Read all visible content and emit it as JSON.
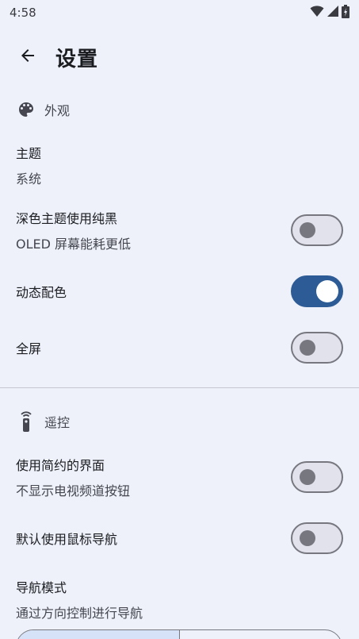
{
  "status_bar": {
    "time": "4:58",
    "icons": [
      "wifi-icon",
      "signal-icon",
      "battery-icon"
    ]
  },
  "header": {
    "title": "设置",
    "back_icon": "arrow-left-icon"
  },
  "appearance": {
    "section_label": "外观",
    "icon": "palette-icon",
    "theme": {
      "title": "主题",
      "value": "系统"
    },
    "pure_black": {
      "title": "深色主题使用纯黑",
      "subtitle": "OLED 屏幕能耗更低",
      "enabled": false
    },
    "dynamic_color": {
      "title": "动态配色",
      "enabled": true
    },
    "fullscreen": {
      "title": "全屏",
      "enabled": false
    }
  },
  "remote": {
    "section_label": "遥控",
    "icon": "remote-icon",
    "simple_ui": {
      "title": "使用简约的界面",
      "subtitle": "不显示电视频道按钮",
      "enabled": false
    },
    "mouse_nav": {
      "title": "默认使用鼠标导航",
      "enabled": false
    },
    "nav_mode": {
      "title": "导航模式",
      "subtitle": "通过方向控制进行导航"
    }
  },
  "colors": {
    "accent": "#2d5b95",
    "background": "#eef1fa",
    "outline": "#76777f"
  }
}
